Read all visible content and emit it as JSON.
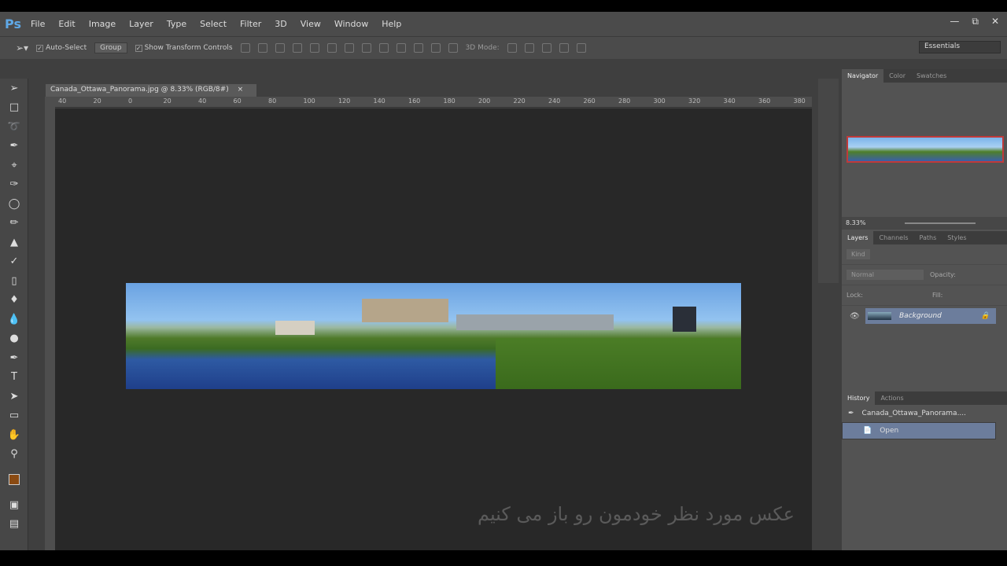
{
  "app": {
    "logo": "Ps"
  },
  "menu": [
    "File",
    "Edit",
    "Image",
    "Layer",
    "Type",
    "Select",
    "Filter",
    "3D",
    "View",
    "Window",
    "Help"
  ],
  "options": {
    "auto_select": "Auto-Select",
    "group": "Group",
    "show_transform": "Show Transform Controls",
    "mode_3d": "3D Mode:",
    "workspace": "Essentials"
  },
  "document": {
    "tab_title": "Canada_Ottawa_Panorama.jpg @ 8.33% (RGB/8#)",
    "close": "×"
  },
  "ruler": [
    "40",
    "20",
    "0",
    "20",
    "40",
    "60",
    "80",
    "100",
    "120",
    "140",
    "160",
    "180",
    "200",
    "220",
    "240",
    "260",
    "280",
    "300",
    "320",
    "340",
    "360",
    "380"
  ],
  "navigator": {
    "tabs": [
      "Navigator",
      "Color",
      "Swatches"
    ],
    "zoom": "8.33%"
  },
  "layers": {
    "tabs": [
      "Layers",
      "Channels",
      "Paths",
      "Styles"
    ],
    "kind": "Kind",
    "blend": "Normal",
    "opacity_label": "Opacity:",
    "lock_label": "Lock:",
    "fill_label": "Fill:",
    "layer_name": "Background"
  },
  "history": {
    "tabs": [
      "History",
      "Actions"
    ],
    "items": [
      "Canada_Ottawa_Panorama....",
      "Open"
    ]
  },
  "subtitle": "عکس مورد نظر خودمون رو باز می کنیم"
}
